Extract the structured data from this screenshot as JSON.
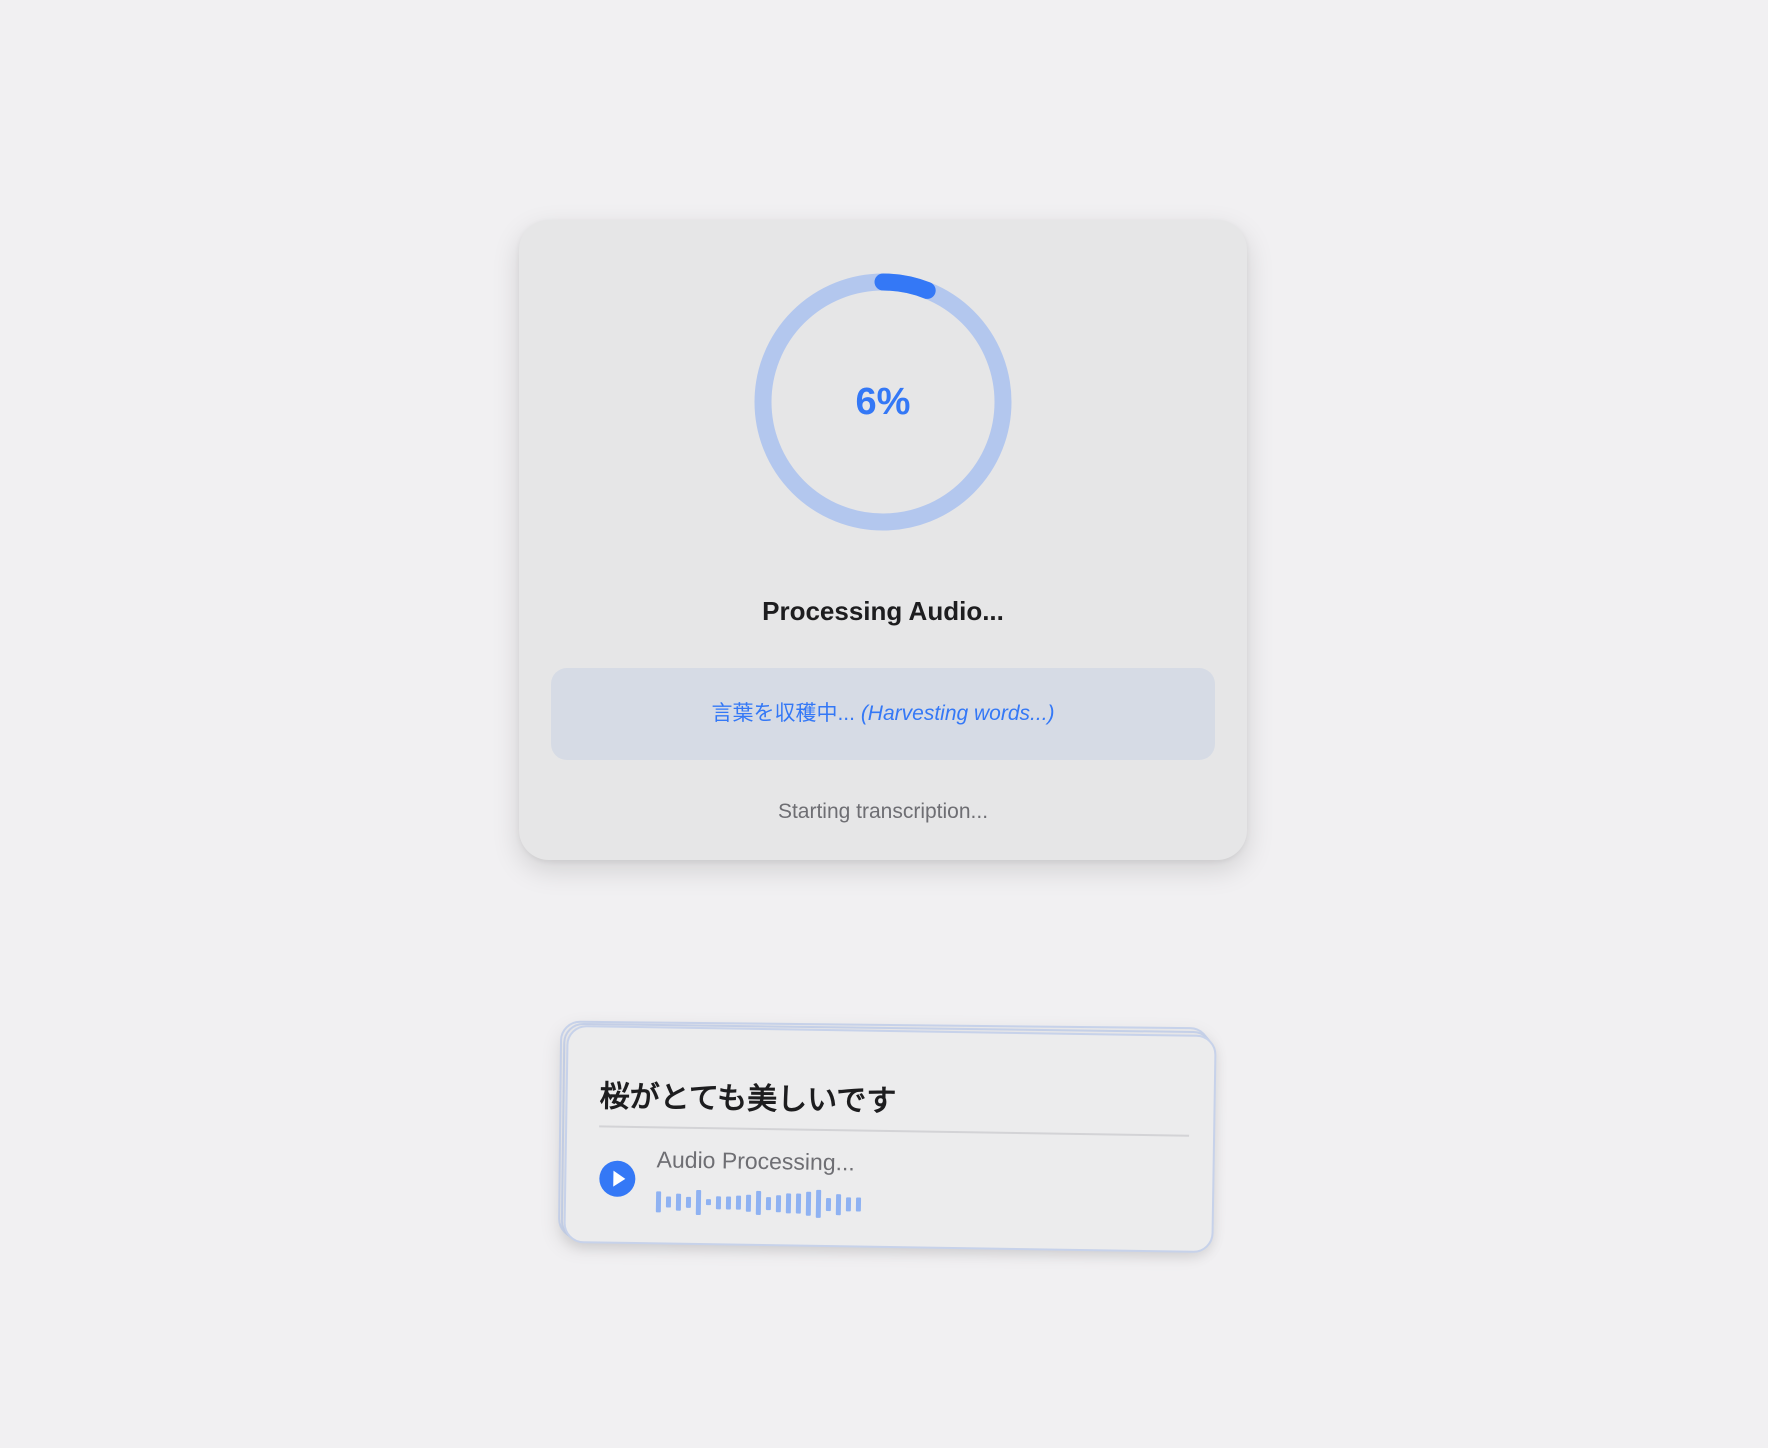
{
  "progress": {
    "percent": 6,
    "percent_label": "6%",
    "title": "Processing Audio...",
    "harvest_jp": "言葉を収穫中...",
    "harvest_en": "(Harvesting words...)",
    "substatus": "Starting transcription..."
  },
  "flashcard": {
    "japanese": "桜がとても美しいです",
    "audio_label": "Audio Processing...",
    "waveform_levels": [
      0.75,
      0.4,
      0.6,
      0.4,
      0.9,
      0.2,
      0.45,
      0.45,
      0.5,
      0.6,
      0.85,
      0.45,
      0.6,
      0.7,
      0.7,
      0.85,
      1.0,
      0.45,
      0.75,
      0.5,
      0.5
    ]
  },
  "colors": {
    "accent": "#3478f6",
    "ring_track": "#b3c7ee",
    "waveform": "#8fb2f2",
    "background": "#f1f0f2"
  },
  "icons": {
    "play": "play-icon"
  }
}
